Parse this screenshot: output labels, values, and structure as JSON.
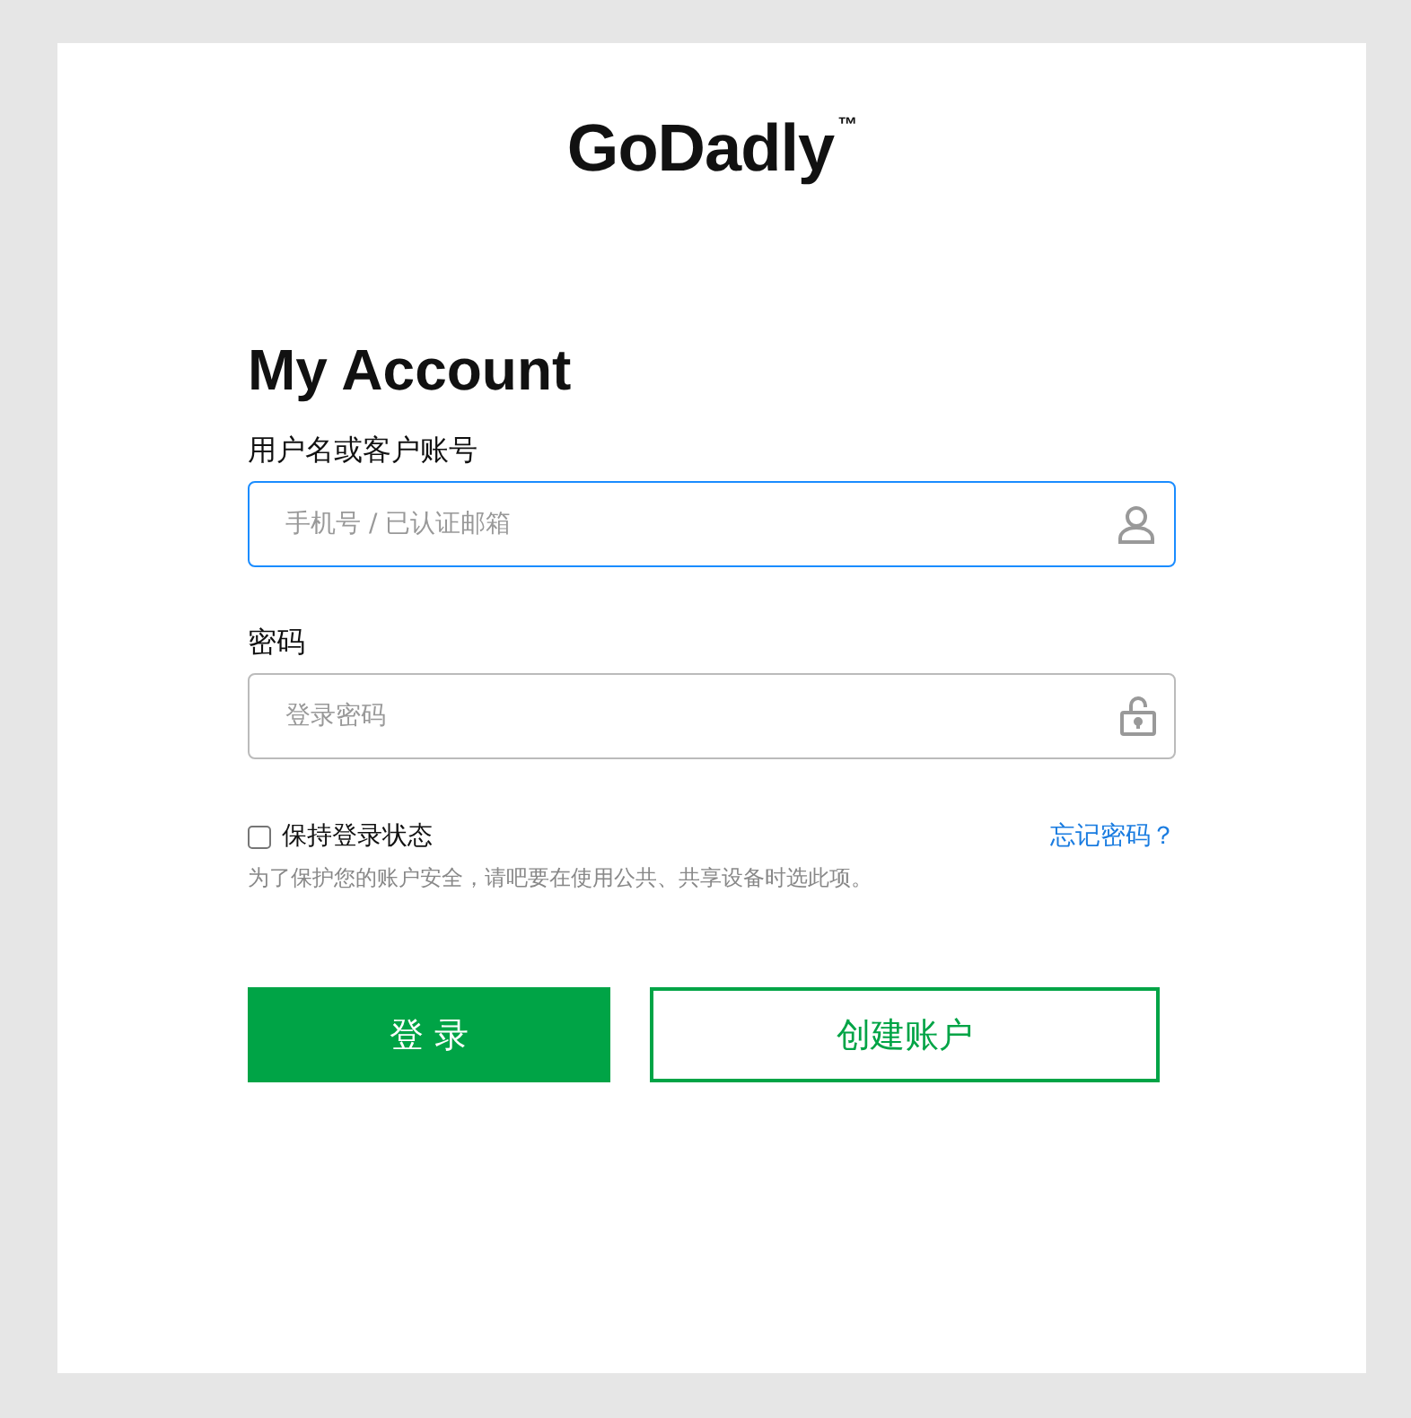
{
  "logo": "GoDadly$^{™}$",
  "title": "My Account",
  "fields": [
    {
      "label": "用户名或客户账号",
      "placeholder": "手机号 / 已认证邮箱",
      "kind": "user",
      "focused": true
    },
    {
      "label": "密码",
      "placeholder": "登录密码",
      "kind": "password",
      "focused": false
    }
  ],
  "remember": {
    "label": "保持登录状态",
    "checked": false
  },
  "forgot_link": "忘记密码？",
  "hint": "为了保护您的账户安全，请吧要在使用公共、共享设备时选此项。",
  "buttons": [
    {
      "label": "登 录",
      "kind": "primary"
    },
    {
      "label": "创建账户",
      "kind": "secondary"
    }
  ]
}
